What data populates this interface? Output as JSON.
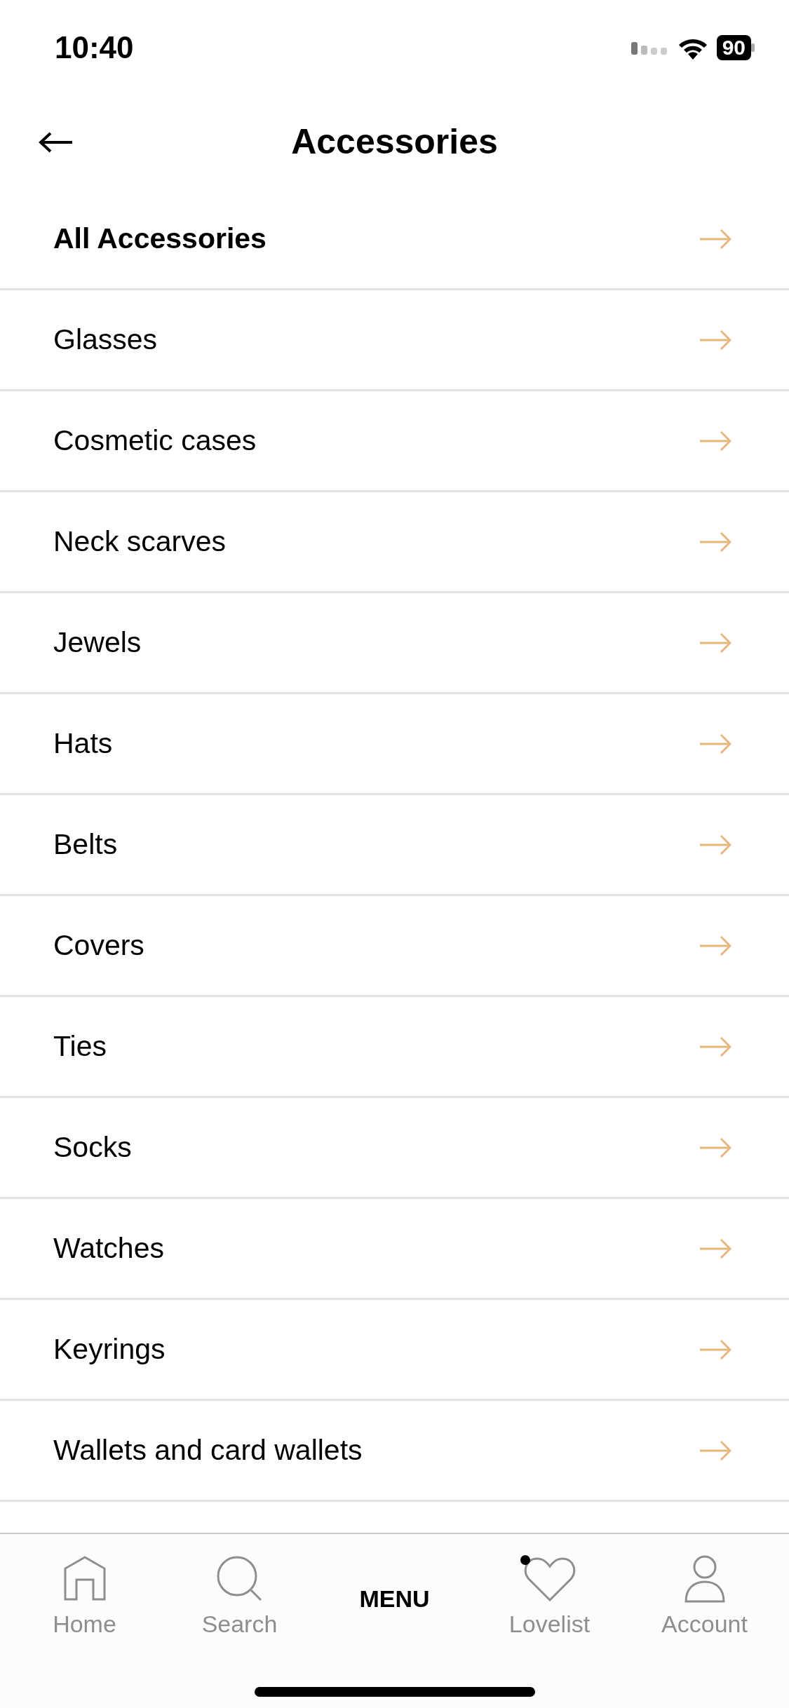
{
  "status_bar": {
    "time": "10:40",
    "battery": "90"
  },
  "header": {
    "title": "Accessories"
  },
  "categories": [
    {
      "label": "All Accessories",
      "emphasized": true
    },
    {
      "label": "Glasses",
      "emphasized": false
    },
    {
      "label": "Cosmetic cases",
      "emphasized": false
    },
    {
      "label": "Neck scarves",
      "emphasized": false
    },
    {
      "label": "Jewels",
      "emphasized": false
    },
    {
      "label": "Hats",
      "emphasized": false
    },
    {
      "label": "Belts",
      "emphasized": false
    },
    {
      "label": "Covers",
      "emphasized": false
    },
    {
      "label": "Ties",
      "emphasized": false
    },
    {
      "label": "Socks",
      "emphasized": false
    },
    {
      "label": "Watches",
      "emphasized": false
    },
    {
      "label": "Keyrings",
      "emphasized": false
    },
    {
      "label": "Wallets and card wallets",
      "emphasized": false
    }
  ],
  "tab_bar": [
    {
      "kind": "home",
      "label": "Home",
      "selected": false,
      "dot": false
    },
    {
      "kind": "search",
      "label": "Search",
      "selected": false,
      "dot": false
    },
    {
      "kind": "menu",
      "label": "MENU",
      "selected": true,
      "dot": false
    },
    {
      "kind": "lovelist",
      "label": "Lovelist",
      "selected": false,
      "dot": true
    },
    {
      "kind": "account",
      "label": "Account",
      "selected": false,
      "dot": false
    }
  ]
}
